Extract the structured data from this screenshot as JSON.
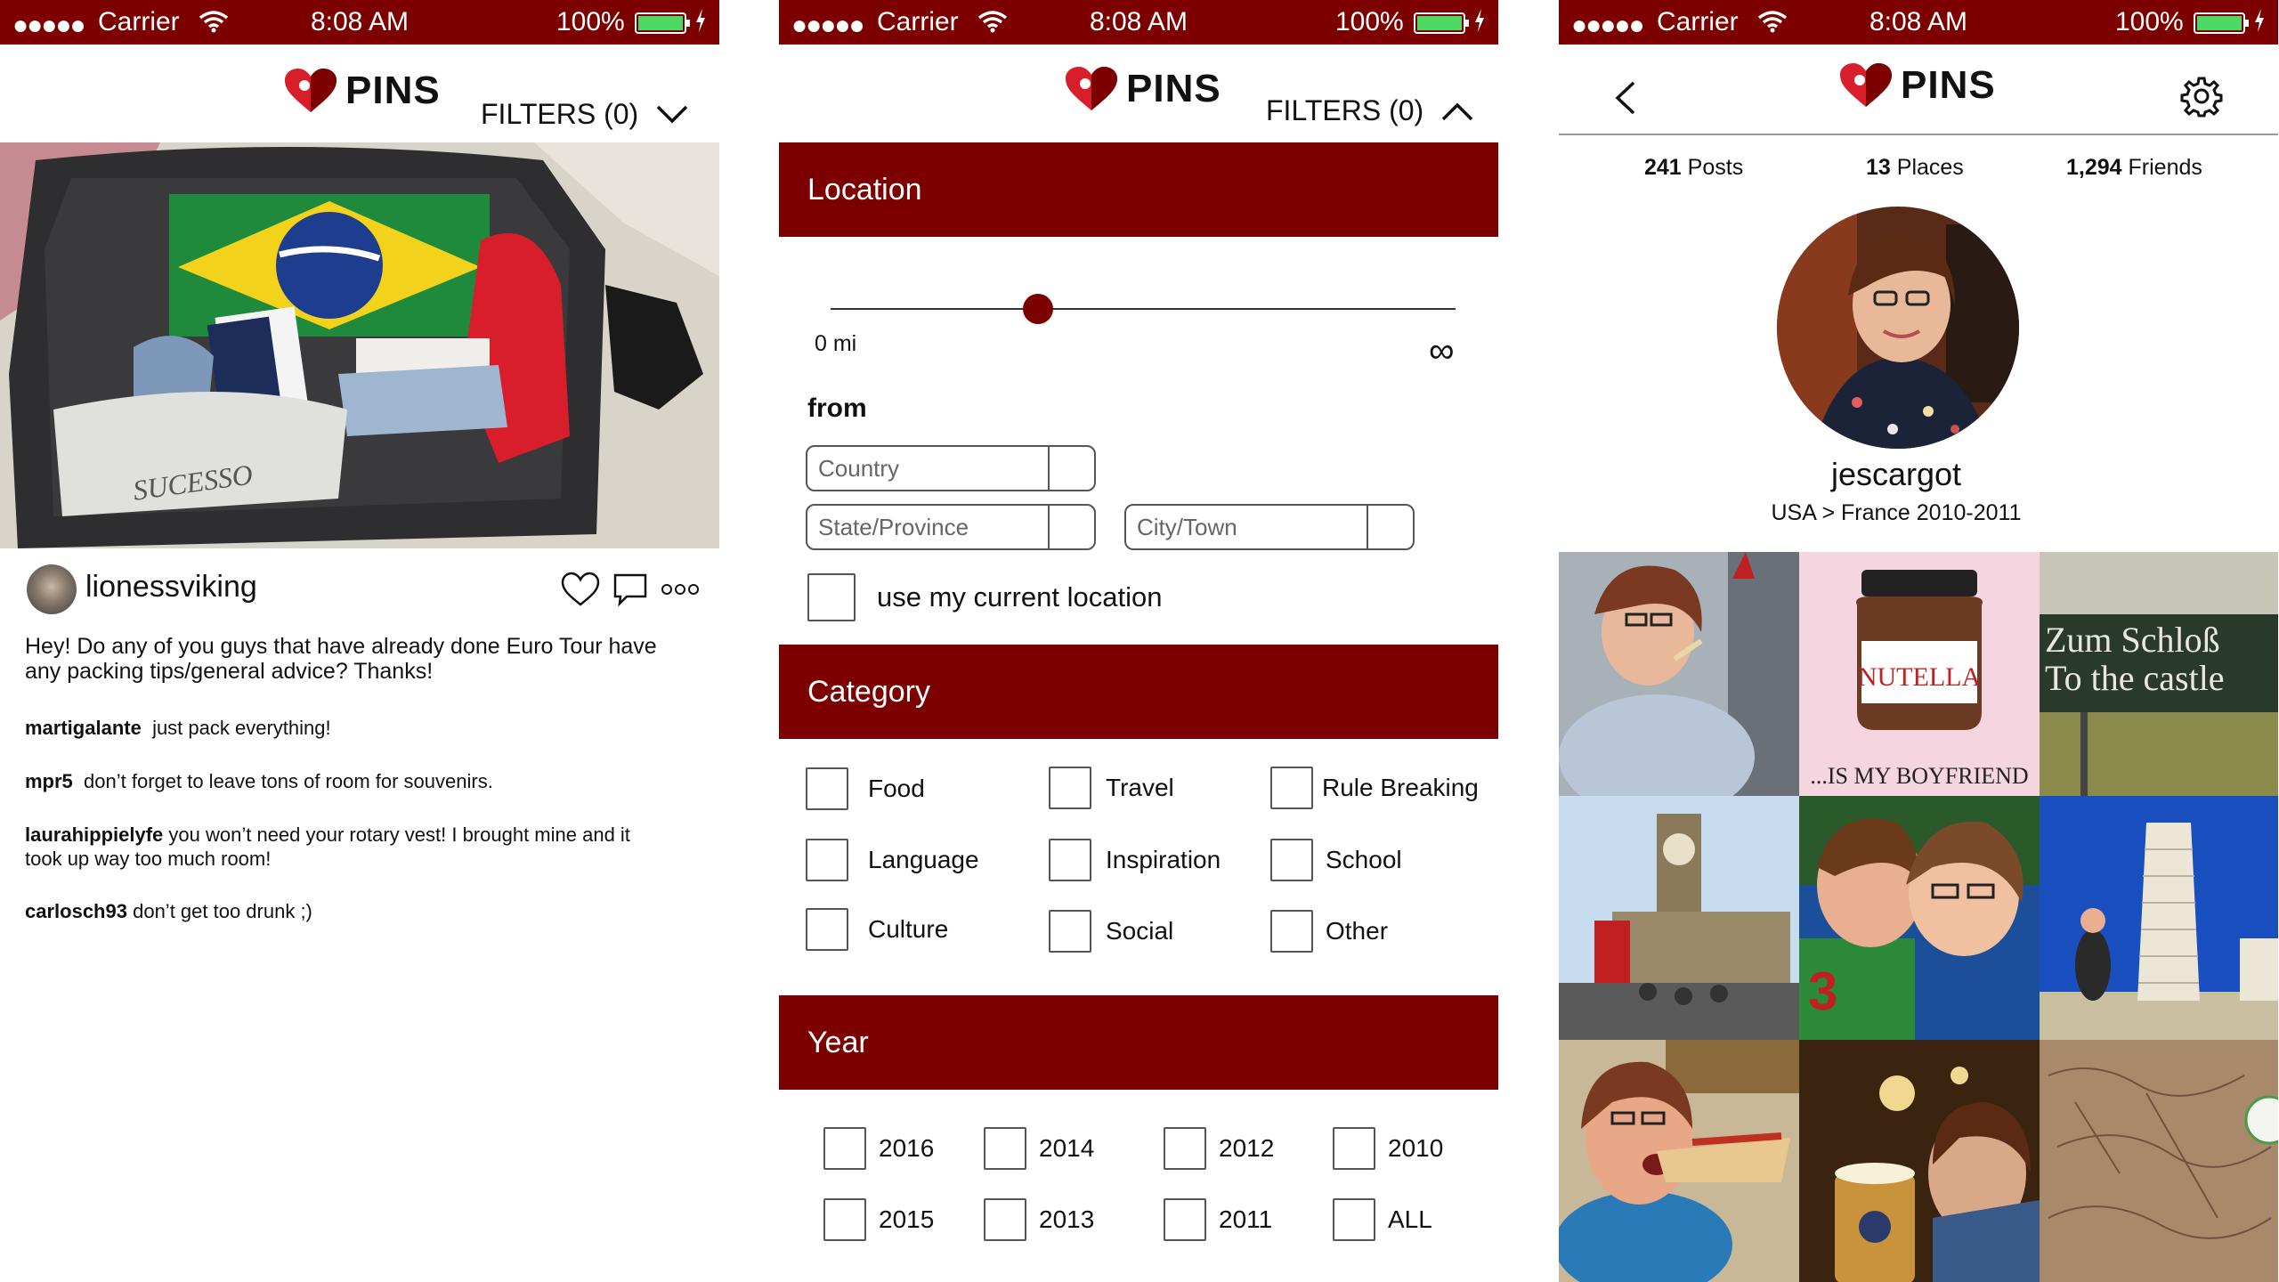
{
  "colors": {
    "accent": "#7d0000",
    "battery": "#4cd964"
  },
  "status_bar": {
    "signal_dots": "●●●●●",
    "carrier": "Carrier",
    "time": "8:08 AM",
    "battery_pct": "100%"
  },
  "app": {
    "logo_text": "PINS"
  },
  "feed": {
    "filters_label": "FILTERS (0)",
    "post": {
      "username": "lionessviking",
      "caption": "Hey! Do any of you guys that have already done Euro Tour have any packing tips/general advice? Thanks!",
      "comments": [
        {
          "user": "martigalante",
          "text": "just pack everything!"
        },
        {
          "user": "mpr5",
          "text": "don’t forget to leave tons of room for souvenirs."
        },
        {
          "user": "laurahippielyfe",
          "text": "you won’t need your rotary vest! I brought mine and it took up way too much room!"
        },
        {
          "user": "carlosch93",
          "text": "don’t get too drunk ;)"
        }
      ],
      "photo_text": "SUCESSO"
    }
  },
  "filters": {
    "filters_label": "FILTERS (0)",
    "location": {
      "title": "Location",
      "slider_min": "0 mi",
      "slider_max": "∞",
      "from_label": "from",
      "country_placeholder": "Country",
      "state_placeholder": "State/Province",
      "city_placeholder": "City/Town",
      "use_current": "use my current location"
    },
    "category": {
      "title": "Category",
      "items": [
        "Food",
        "Travel",
        "Rule Breaking",
        "Language",
        "Inspiration",
        "School",
        "Culture",
        "Social",
        "Other"
      ]
    },
    "year": {
      "title": "Year",
      "items": [
        "2016",
        "2014",
        "2012",
        "2010",
        "2015",
        "2013",
        "2011",
        "ALL"
      ]
    }
  },
  "profile": {
    "stats": {
      "posts": "241",
      "posts_label": "Posts",
      "places": "13",
      "places_label": "Places",
      "friends": "1,294",
      "friends_label": "Friends"
    },
    "username": "jescargot",
    "subtitle": "USA > France 2010-2011",
    "grid_text": {
      "nutella": "NUTELLA",
      "boyfriend": "...IS MY BOYFRIEND",
      "sign_line1": "Zum Schloß",
      "sign_line2": "To the castle"
    }
  }
}
